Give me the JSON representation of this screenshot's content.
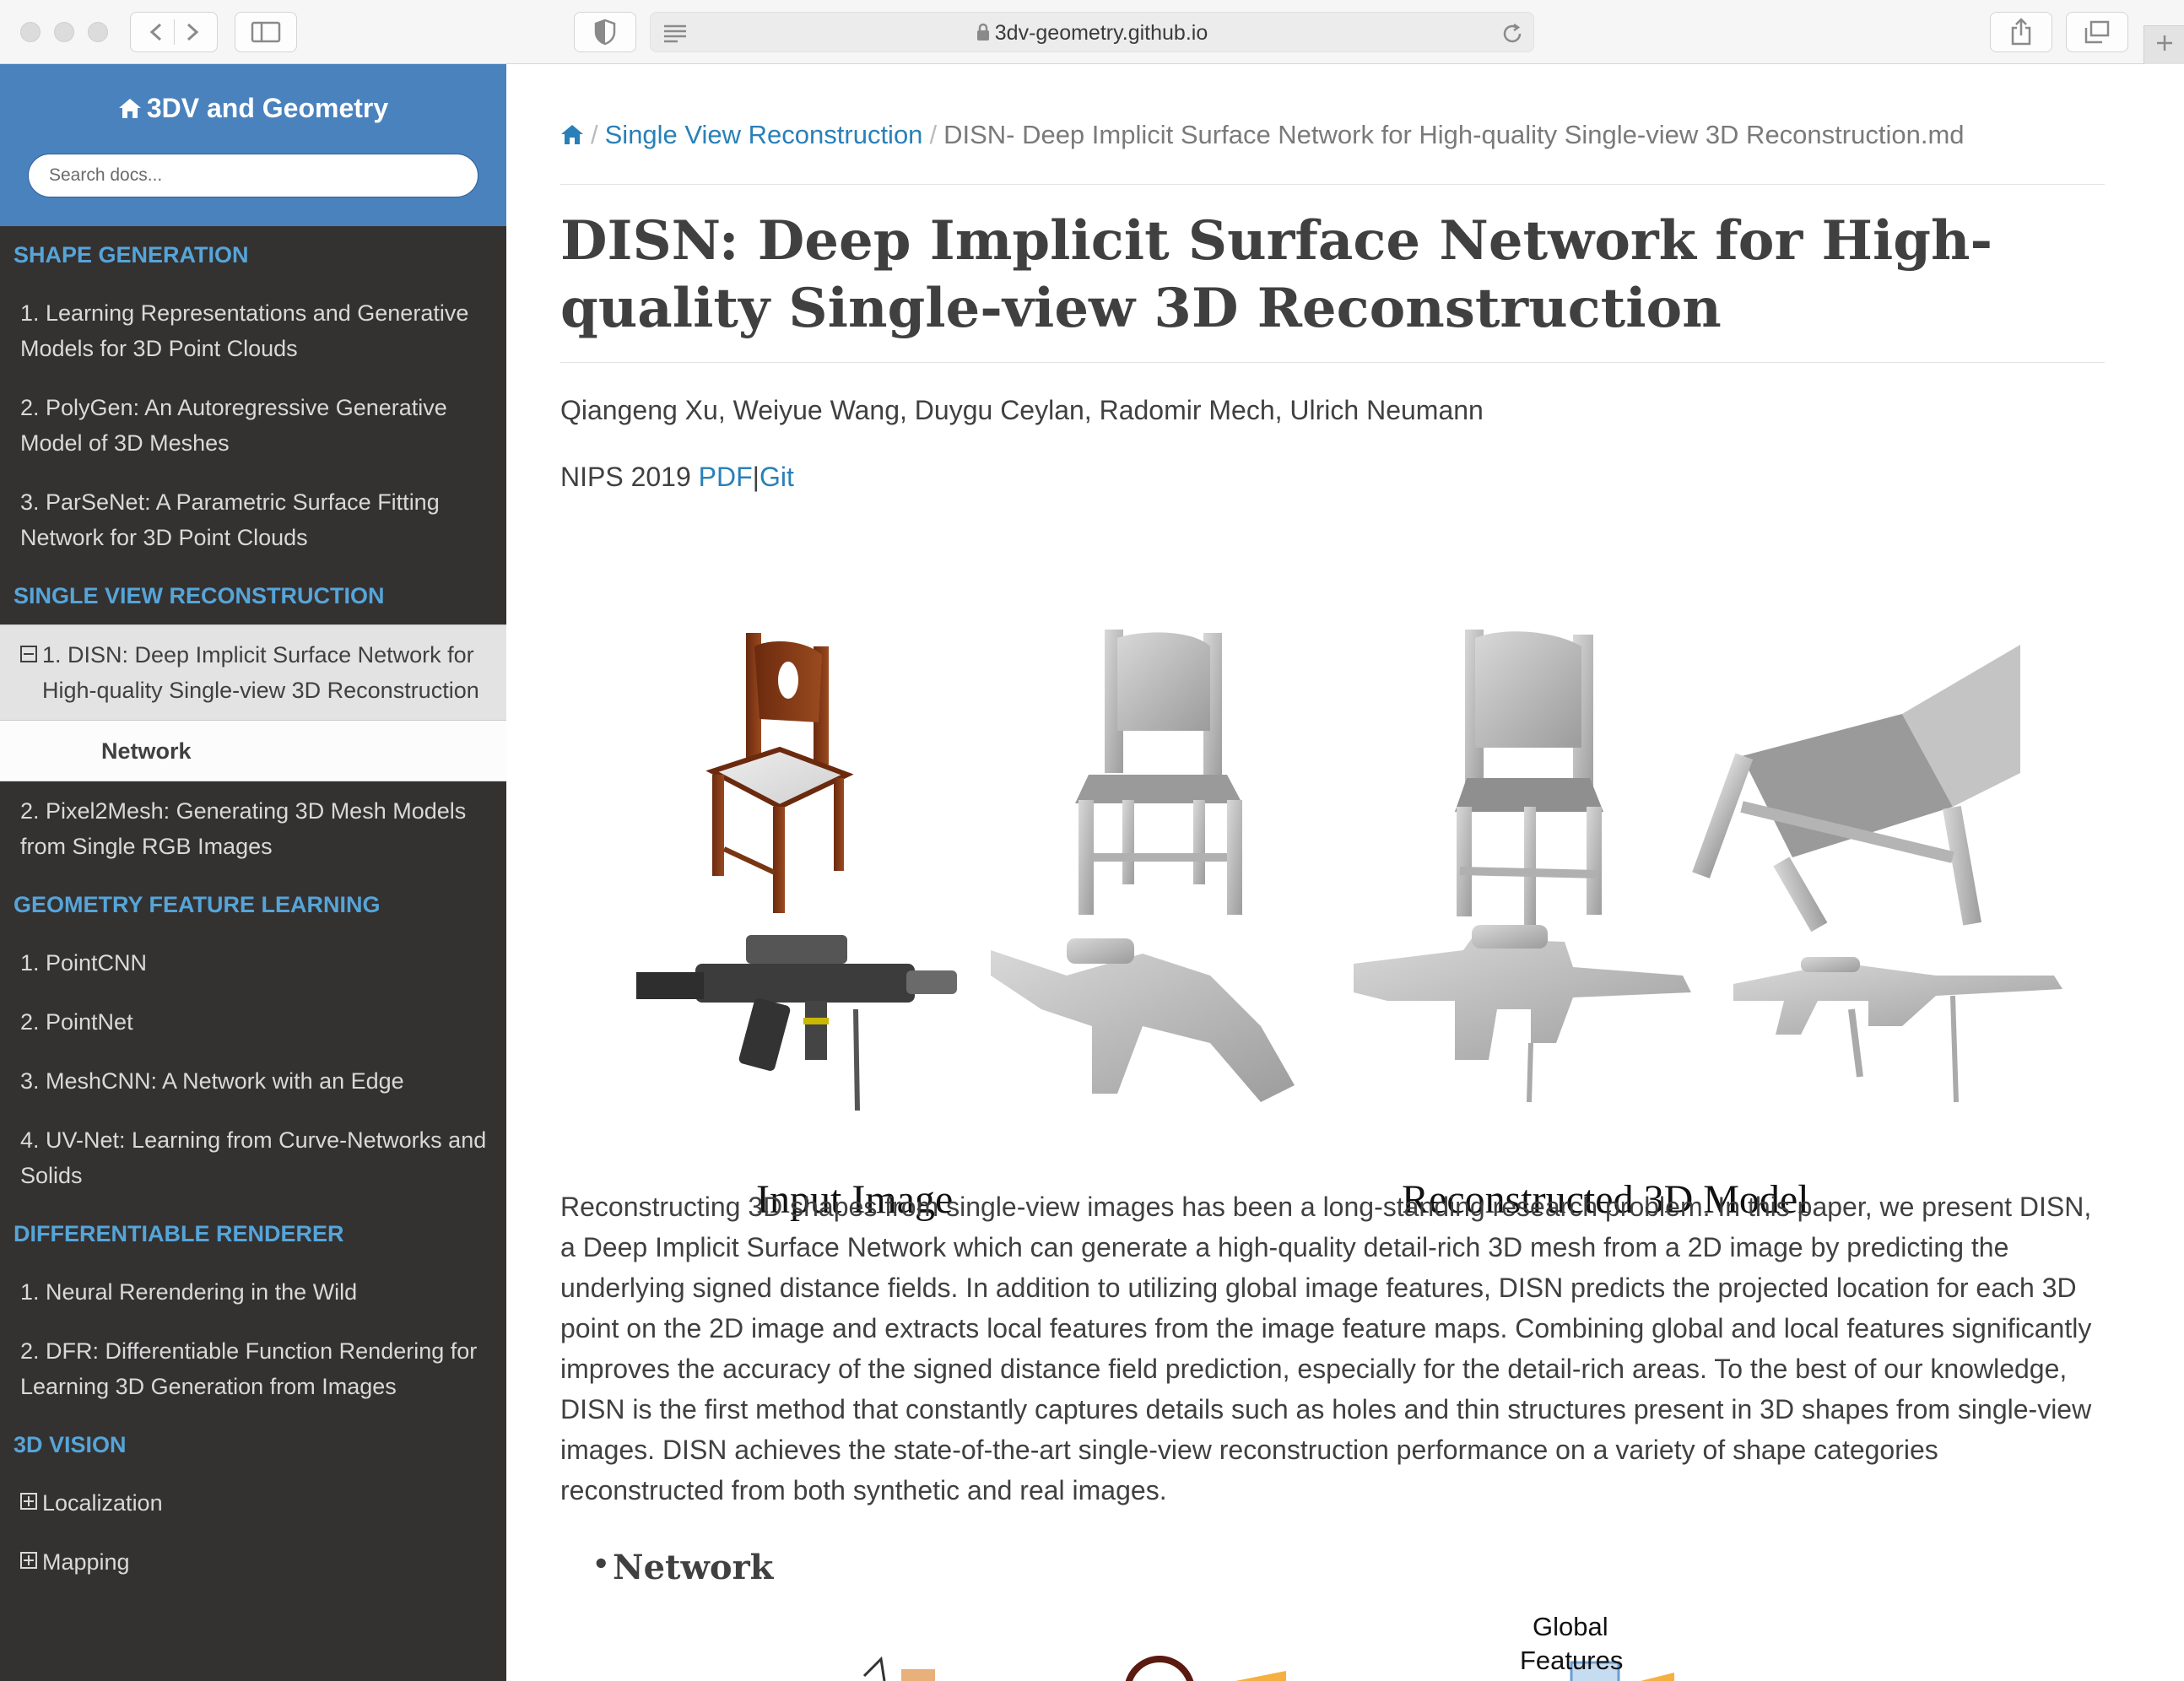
{
  "browser": {
    "url": "3dv-geometry.github.io"
  },
  "sidebar": {
    "site_title": "3DV and Geometry",
    "search_placeholder": "Search docs...",
    "sections": [
      {
        "caption": "SHAPE GENERATION",
        "items": [
          "1. Learning Representations and Generative Models for 3D Point Clouds",
          "2. PolyGen: An Autoregressive Generative Model of 3D Meshes",
          "3. ParSeNet: A Parametric Surface Fitting Network for 3D Point Clouds"
        ]
      },
      {
        "caption": "SINGLE VIEW RECONSTRUCTION",
        "current_item": "1. DISN: Deep Implicit Surface Network for High-quality Single-view 3D Reconstruction",
        "sub_item": "Network",
        "items": [
          "2. Pixel2Mesh: Generating 3D Mesh Models from Single RGB Images"
        ]
      },
      {
        "caption": "GEOMETRY FEATURE LEARNING",
        "items": [
          "1. PointCNN",
          "2. PointNet",
          "3. MeshCNN: A Network with an Edge",
          "4. UV-Net: Learning from Curve-Networks and Solids"
        ]
      },
      {
        "caption": "DIFFERENTIABLE RENDERER",
        "items": [
          "1. Neural Rerendering in the Wild",
          "2. DFR: Differentiable Function Rendering for Learning 3D Generation from Images"
        ]
      },
      {
        "caption": "3D VISION",
        "collapsed_items": [
          "Localization",
          "Mapping"
        ]
      }
    ]
  },
  "breadcrumb": {
    "section": "Single View Reconstruction",
    "separator": "/",
    "page": "DISN- Deep Implicit Surface Network for High-quality Single-view 3D Reconstruction.md"
  },
  "article": {
    "title": "DISN: Deep Implicit Surface Network for High-quality Single-view 3D Reconstruction",
    "authors": "Qiangeng Xu, Weiyue Wang, Duygu Ceylan, Radomir Mech, Ulrich Neumann",
    "venue": "NIPS 2019",
    "pdf_link": "PDF",
    "link_separator": "|",
    "git_link": "Git",
    "figure": {
      "caption_input": "Input Image",
      "caption_reconstructed": "Reconstructed 3D Model"
    },
    "abstract": "Reconstructing 3D shapes from single-view images has been a long-standing research problem. In this paper, we present DISN, a Deep Implicit Surface Network which can generate a high-quality detail-rich 3D mesh from a 2D image by predicting the underlying signed distance fields. In addition to utilizing global image features, DISN predicts the projected location for each 3D point on the 2D image and extracts local features from the image feature maps. Combining global and local features significantly improves the accuracy of the signed distance field prediction, especially for the detail-rich areas. To the best of our knowledge, DISN is the first method that constantly captures details such as holes and thin structures present in 3D shapes from single-view images. DISN achieves the state-of-the-art single-view reconstruction performance on a variety of shape categories reconstructed from both synthetic and real images.",
    "section_heading": "Network",
    "diagram_label_1": "Global",
    "diagram_label_2": "Features"
  },
  "colors": {
    "sidebar_bg": "#343131",
    "sidebar_header": "#4a82be",
    "caption_blue": "#55a5d9",
    "link_blue": "#2980b9"
  }
}
